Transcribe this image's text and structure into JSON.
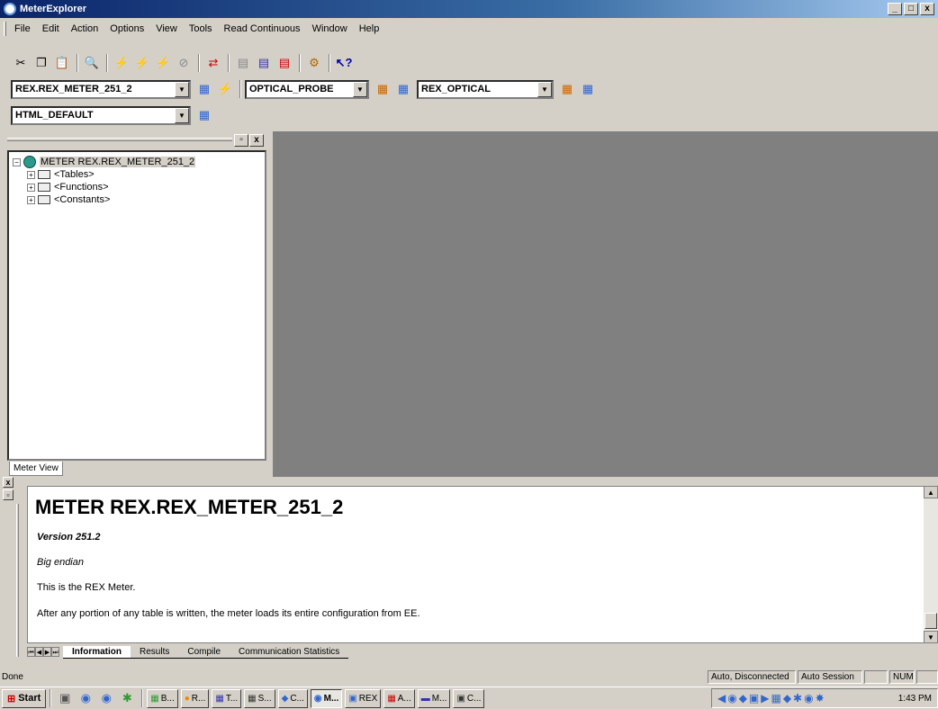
{
  "window": {
    "title": "MeterExplorer",
    "min": "_",
    "max": "□",
    "close": "x"
  },
  "menu": [
    "File",
    "Edit",
    "Action",
    "Options",
    "View",
    "Tools",
    "Read Continuous",
    "Window",
    "Help"
  ],
  "toolbar2": {
    "meter_combo": "REX.REX_METER_251_2",
    "probe_combo": "OPTICAL_PROBE",
    "optical_combo": "REX_OPTICAL"
  },
  "toolbar3": {
    "html_combo": "HTML_DEFAULT"
  },
  "tree": {
    "root": "METER REX.REX_METER_251_2",
    "children": [
      "<Tables>",
      "<Functions>",
      "<Constants>"
    ]
  },
  "left_tab": "Meter View",
  "info": {
    "heading": "METER REX.REX_METER_251_2",
    "version": "Version 251.2",
    "endian": "Big endian",
    "desc": "This is the REX Meter.",
    "note": "After any portion of any table is written, the meter loads its entire configuration from EE."
  },
  "tabs": [
    "Information",
    "Results",
    "Compile",
    "Communication Statistics"
  ],
  "status": {
    "left": "Done",
    "conn": "Auto, Disconnected",
    "session": "Auto Session",
    "num": "NUM"
  },
  "taskbar": {
    "start": "Start",
    "buttons": [
      "B...",
      "R...",
      "T...",
      "S...",
      "C...",
      "M...",
      "REX",
      "A...",
      "M...",
      "C..."
    ],
    "clock": "1:43 PM"
  }
}
